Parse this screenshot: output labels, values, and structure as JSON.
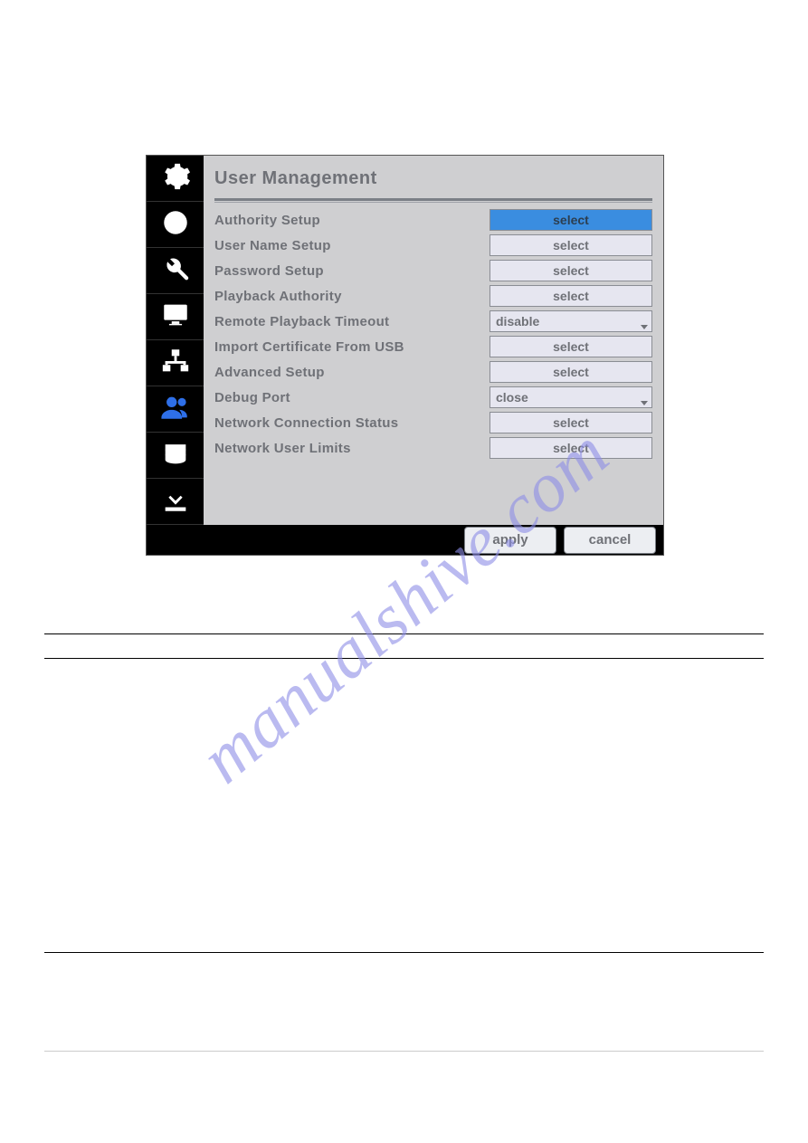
{
  "panel": {
    "title": "User  Management"
  },
  "rows": [
    {
      "label": "Authority  Setup",
      "control": "select",
      "type": "select",
      "highlight": true
    },
    {
      "label": "User  Name  Setup",
      "control": "select",
      "type": "select",
      "highlight": false
    },
    {
      "label": "Password  Setup",
      "control": "select",
      "type": "select",
      "highlight": false
    },
    {
      "label": "Playback  Authority",
      "control": "select",
      "type": "select",
      "highlight": false
    },
    {
      "label": "Remote  Playback  Timeout",
      "control": "disable",
      "type": "dropdown",
      "highlight": false
    },
    {
      "label": "Import  Certificate  From  USB",
      "control": "select",
      "type": "select",
      "highlight": false
    },
    {
      "label": "Advanced  Setup",
      "control": "select",
      "type": "select",
      "highlight": false
    },
    {
      "label": "Debug  Port",
      "control": "close",
      "type": "dropdown",
      "highlight": false
    },
    {
      "label": "Network  Connection  Status",
      "control": "select",
      "type": "select",
      "highlight": false
    },
    {
      "label": "Network  User  Limits",
      "control": "select",
      "type": "select",
      "highlight": false
    }
  ],
  "footer": {
    "apply": "apply",
    "cancel": "cancel"
  },
  "watermark": "manualshive.com",
  "sidebar_active_index": 6
}
